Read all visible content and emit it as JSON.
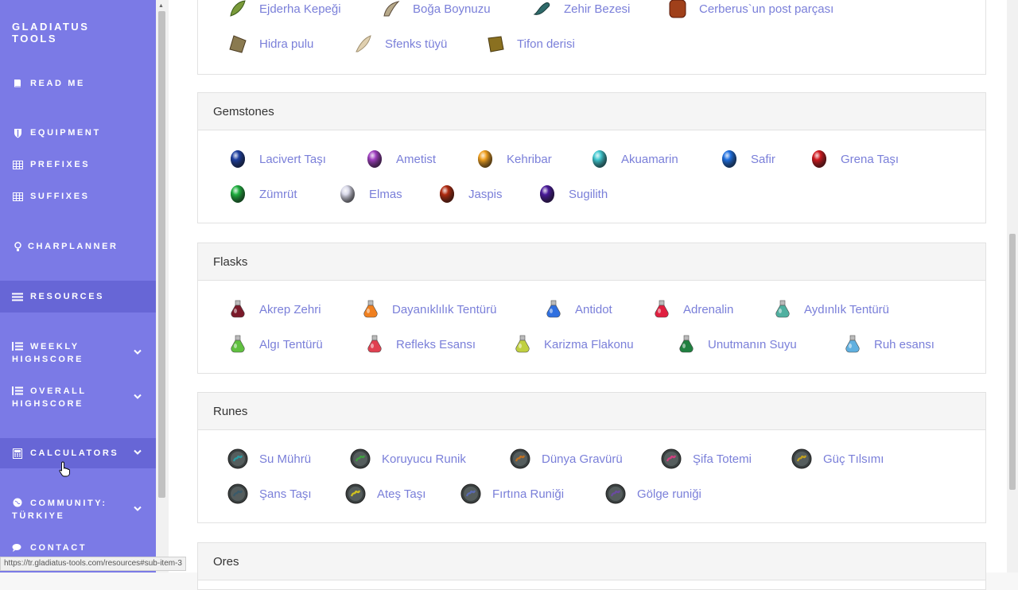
{
  "sidebar": {
    "brand": "GLADIATUS TOOLS",
    "items": [
      {
        "label": "READ ME",
        "icon": "book-icon"
      },
      {
        "label": "EQUIPMENT",
        "icon": "shield-icon"
      },
      {
        "label": "PREFIXES",
        "icon": "table-icon"
      },
      {
        "label": "SUFFIXES",
        "icon": "table-icon"
      },
      {
        "label": "CHARPLANNER",
        "icon": "lightbulb-icon"
      },
      {
        "label": "RESOURCES",
        "icon": "list-icon"
      },
      {
        "label": "WEEKLY HIGHSCORE",
        "icon": "list-ol-icon"
      },
      {
        "label": "OVERALL HIGHSCORE",
        "icon": "list-ol-icon"
      },
      {
        "label": "CALCULATORS",
        "icon": "calculator-icon"
      },
      {
        "label": "COMMUNITY: TÜRKIYE",
        "icon": "globe-icon"
      },
      {
        "label": "CONTACT",
        "icon": "comments-icon"
      }
    ]
  },
  "top_items": [
    {
      "name": "Ejderha Kepeği",
      "color": "#7a9a3a"
    },
    {
      "name": "Boğa Boynuzu",
      "color": "#b7a98a"
    },
    {
      "name": "Zehir Bezesi",
      "color": "#2e6a6a"
    },
    {
      "name": "Cerberus`un post parçası",
      "color": "#a0401a"
    },
    {
      "name": "Hidra pulu",
      "color": "#8a7a50"
    },
    {
      "name": "Sfenks tüyü",
      "color": "#d8c8a8"
    },
    {
      "name": "Tifon derisi",
      "color": "#8a7020"
    }
  ],
  "gemstones": {
    "title": "Gemstones",
    "items": [
      {
        "name": "Lacivert Taşı",
        "color": "#1e3fa0"
      },
      {
        "name": "Ametist",
        "color": "#a040c0"
      },
      {
        "name": "Kehribar",
        "color": "#f0a020"
      },
      {
        "name": "Akuamarin",
        "color": "#40c8d0"
      },
      {
        "name": "Safir",
        "color": "#2070e0"
      },
      {
        "name": "Grena Taşı",
        "color": "#d01a20"
      },
      {
        "name": "Zümrüt",
        "color": "#20b040"
      },
      {
        "name": "Elmas",
        "color": "#d8d8e8"
      },
      {
        "name": "Jaspis",
        "color": "#b02a10"
      },
      {
        "name": "Sugilith",
        "color": "#4a1a9a"
      }
    ]
  },
  "flasks": {
    "title": "Flasks",
    "items": [
      {
        "name": "Akrep Zehri",
        "color": "#7a1a2a"
      },
      {
        "name": "Dayanıklılık Tentürü",
        "color": "#f08020"
      },
      {
        "name": "Antidot",
        "color": "#3070e0"
      },
      {
        "name": "Adrenalin",
        "color": "#e02040"
      },
      {
        "name": "Aydınlık Tentürü",
        "color": "#50b0a0"
      },
      {
        "name": "Algı Tentürü",
        "color": "#60c040"
      },
      {
        "name": "Refleks Esansı",
        "color": "#e04050"
      },
      {
        "name": "Karizma Flakonu",
        "color": "#c0d040"
      },
      {
        "name": "Unutmanın Suyu",
        "color": "#208040"
      },
      {
        "name": "Ruh esansı",
        "color": "#60b0e0"
      }
    ]
  },
  "runes": {
    "title": "Runes",
    "items": [
      {
        "name": "Su Mührü",
        "color": "#2a9aa0"
      },
      {
        "name": "Koruyucu Runik",
        "color": "#40a040"
      },
      {
        "name": "Dünya Gravürü",
        "color": "#c07020"
      },
      {
        "name": "Şifa Totemi",
        "color": "#d04080"
      },
      {
        "name": "Güç Tılsımı",
        "color": "#c0a020"
      },
      {
        "name": "Şans Taşı",
        "color": "#3a5a6a"
      },
      {
        "name": "Ateş Taşı",
        "color": "#d0c020"
      },
      {
        "name": "Fırtına Runiği",
        "color": "#5a6ab0"
      },
      {
        "name": "Gölge runiği",
        "color": "#6a4aa0"
      }
    ]
  },
  "ores": {
    "title": "Ores"
  },
  "status_url": "https://tr.gladiatus-tools.com/resources#sub-item-3"
}
